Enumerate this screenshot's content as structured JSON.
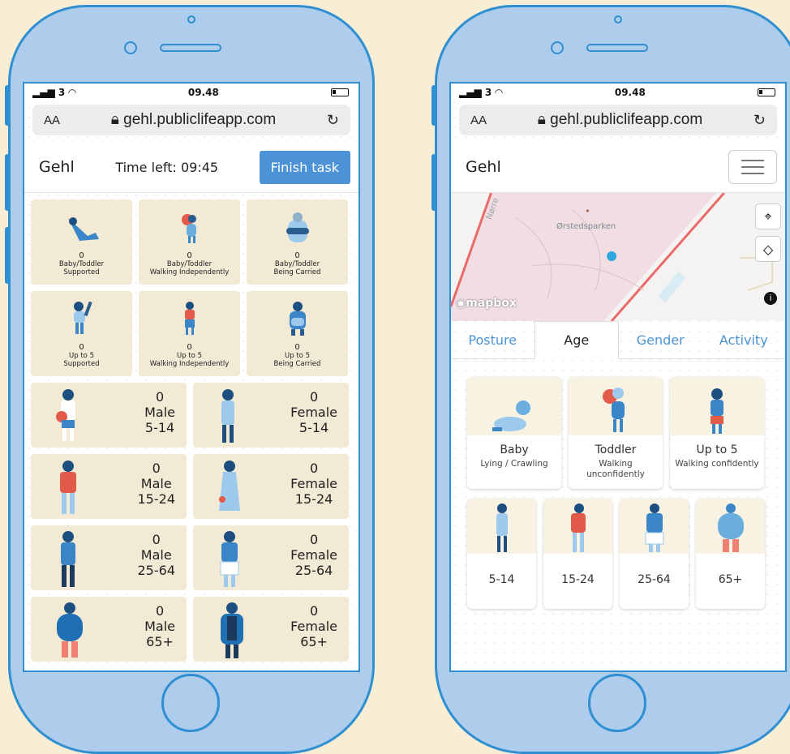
{
  "colors": {
    "accent": "#4b93d6",
    "tile_bg": "#f2ead5",
    "phone": "#aecdec",
    "figure_blue": "#3a86c8",
    "figure_red": "#e25a4a"
  },
  "left_phone": {
    "status": {
      "signal": "3",
      "time": "09.48"
    },
    "browser": {
      "aa": "AA",
      "url": "gehl.publiclifeapp.com"
    },
    "navbar": {
      "brand": "Gehl",
      "time_left": "Time left: 09:45",
      "finish_button": "Finish task"
    },
    "small_tiles": [
      {
        "count": "0",
        "line1": "Baby/Toddler",
        "line2": "Supported"
      },
      {
        "count": "0",
        "line1": "Baby/Toddler",
        "line2": "Walking Independently"
      },
      {
        "count": "0",
        "line1": "Baby/Toddler",
        "line2": "Being Carried"
      },
      {
        "count": "0",
        "line1": "Up to 5",
        "line2": "Supported"
      },
      {
        "count": "0",
        "line1": "Up to 5",
        "line2": "Walking Independently"
      },
      {
        "count": "0",
        "line1": "Up to 5",
        "line2": "Being Carried"
      }
    ],
    "wide_tiles": [
      {
        "count": "0",
        "gender": "Male",
        "age": "5-14"
      },
      {
        "count": "0",
        "gender": "Female",
        "age": "5-14"
      },
      {
        "count": "0",
        "gender": "Male",
        "age": "15-24"
      },
      {
        "count": "0",
        "gender": "Female",
        "age": "15-24"
      },
      {
        "count": "0",
        "gender": "Male",
        "age": "25-64"
      },
      {
        "count": "0",
        "gender": "Female",
        "age": "25-64"
      },
      {
        "count": "0",
        "gender": "Male",
        "age": "65+"
      },
      {
        "count": "0",
        "gender": "Female",
        "age": "65+"
      }
    ]
  },
  "right_phone": {
    "status": {
      "signal": "3",
      "time": "09.48"
    },
    "browser": {
      "aa": "AA",
      "url": "gehl.publiclifeapp.com"
    },
    "navbar": {
      "brand": "Gehl"
    },
    "map": {
      "park_label": "Ørstedsparken",
      "street_label": "Nørre",
      "logo": "mapbox"
    },
    "tabs": [
      "Posture",
      "Age",
      "Gender",
      "Activity"
    ],
    "active_tab": "Age",
    "age_cards": [
      {
        "title": "Baby",
        "sub": "Lying / Crawling"
      },
      {
        "title": "Toddler",
        "sub": "Walking unconfidently"
      },
      {
        "title": "Up to 5",
        "sub": "Walking confidently"
      }
    ],
    "age_ranges": [
      "5-14",
      "15-24",
      "25-64",
      "65+"
    ]
  }
}
